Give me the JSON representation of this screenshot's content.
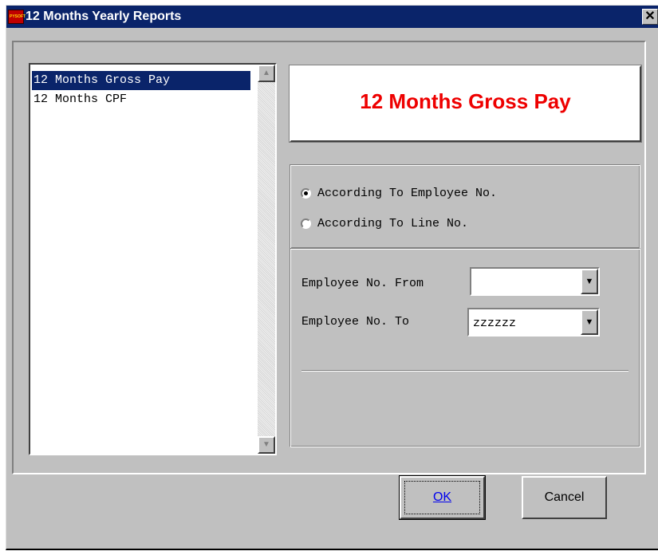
{
  "window": {
    "title": "12 Months Yearly Reports",
    "app_icon_text": "PYSOFT",
    "close_glyph": "✕"
  },
  "report_list": {
    "items": [
      {
        "label": "12 Months Gross Pay",
        "selected": true
      },
      {
        "label": "12 Months CPF",
        "selected": false
      }
    ],
    "scroll_up_glyph": "▲",
    "scroll_down_glyph": "▼"
  },
  "report_title": {
    "text": "12 Months Gross Pay",
    "color": "#ee0000"
  },
  "sort_options": {
    "by_employee_no": "According To Employee No.",
    "by_line_no": "According To Line No.",
    "selected": "by_employee_no"
  },
  "filters": {
    "from_label": "Employee No. From",
    "from_value": "",
    "to_label": "Employee No. To",
    "to_value": "zzzzzz",
    "dropdown_glyph": "▼"
  },
  "buttons": {
    "ok_label": "OK",
    "cancel_label": "Cancel"
  },
  "colors": {
    "titlebar": "#0a246a",
    "dialog_bg": "#c0c0c0",
    "selection": "#0a246a"
  }
}
